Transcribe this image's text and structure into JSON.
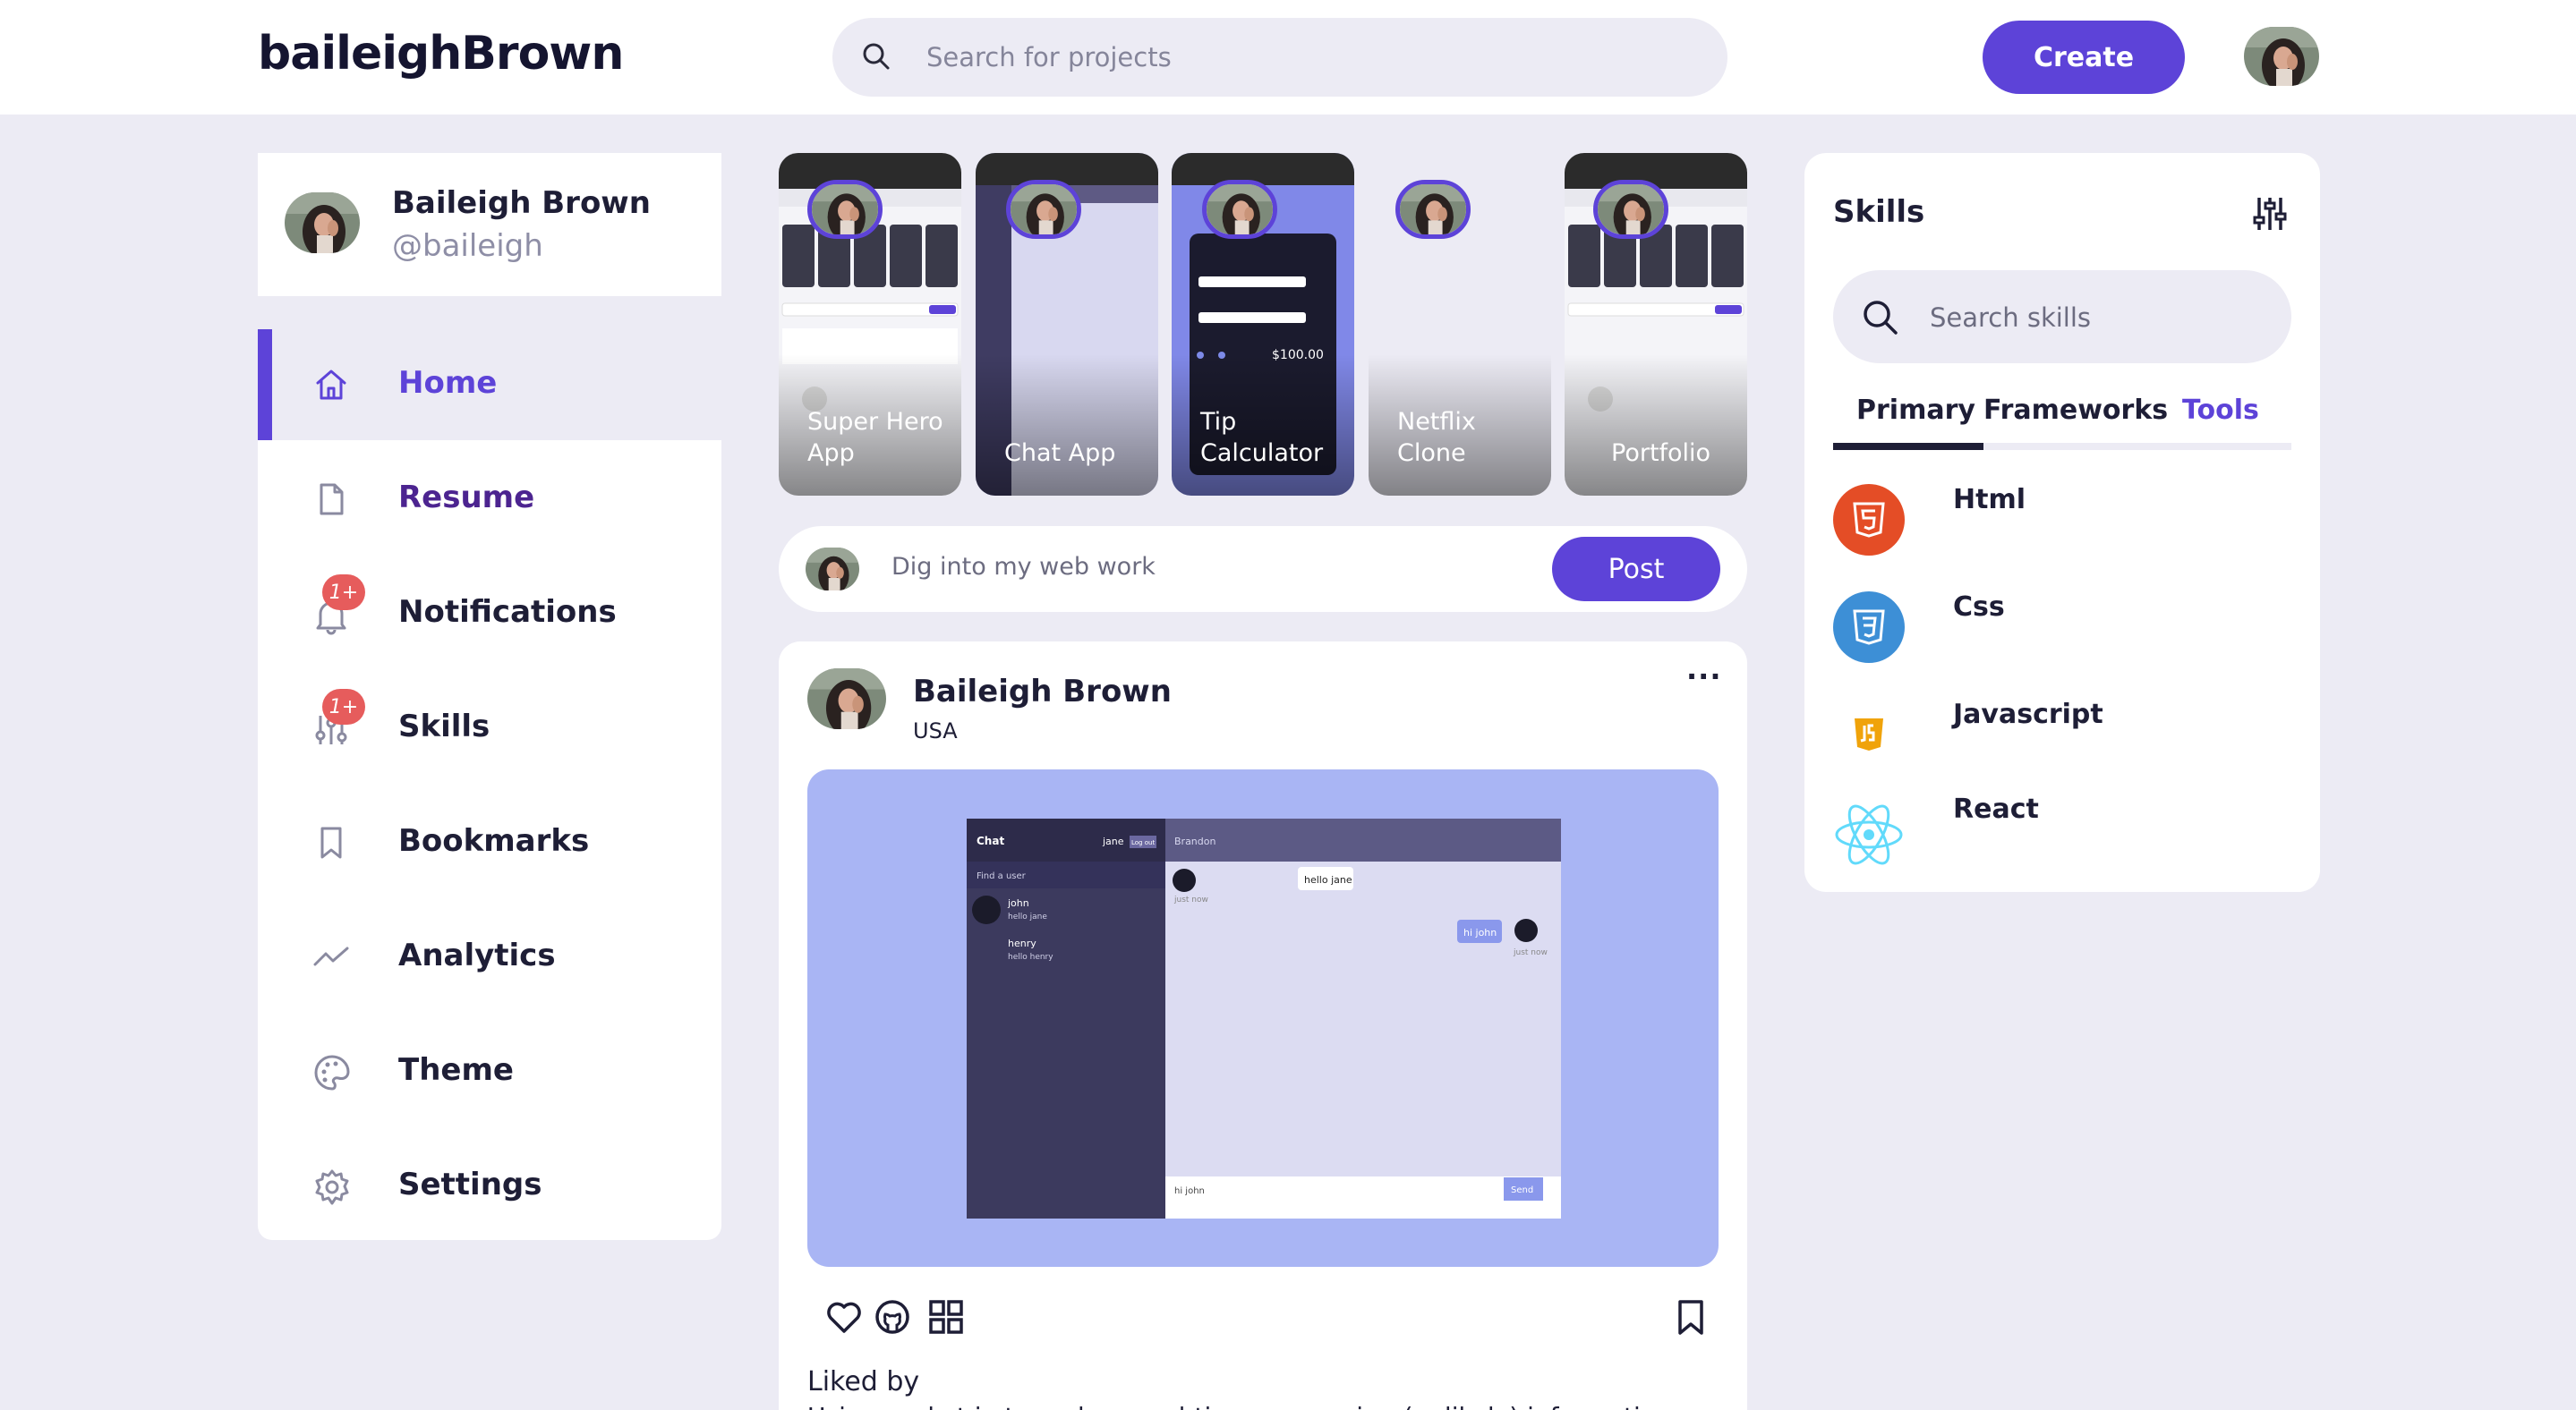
{
  "header": {
    "logo": "baileighBrown",
    "search_placeholder": "Search for projects",
    "create_label": "Create"
  },
  "profile": {
    "name": "Baileigh Brown",
    "handle": "@baileigh"
  },
  "nav": {
    "items": [
      {
        "label": "Home",
        "icon": "home-icon",
        "active": true
      },
      {
        "label": "Resume",
        "icon": "file-icon"
      },
      {
        "label": "Notifications",
        "icon": "bell-icon",
        "badge": "1+"
      },
      {
        "label": "Skills",
        "icon": "sliders-icon",
        "badge": "1+"
      },
      {
        "label": "Bookmarks",
        "icon": "bookmark-icon"
      },
      {
        "label": "Analytics",
        "icon": "trend-icon"
      },
      {
        "label": "Theme",
        "icon": "palette-icon"
      },
      {
        "label": "Settings",
        "icon": "gear-icon"
      }
    ]
  },
  "stories": [
    {
      "title": "Super Hero App"
    },
    {
      "title": "Chat App"
    },
    {
      "title": "Tip Calculator"
    },
    {
      "title": "Netflix Clone"
    },
    {
      "title": "Portfolio"
    }
  ],
  "composer": {
    "placeholder": "Dig into my web work",
    "post_label": "Post"
  },
  "post": {
    "author": "Baileigh Brown",
    "location": "USA",
    "more": "···",
    "liked_by": "Liked by",
    "caption_partial": "Using socket.io to make a real-time messaging (unlikely) information",
    "screenshot": {
      "sidebar_title": "Chat",
      "user": "jane",
      "logout": "Log out",
      "find": "Find a user",
      "contacts": [
        {
          "name": "john",
          "last": "hello jane"
        },
        {
          "name": "henry",
          "last": "hello henry"
        }
      ],
      "chat_with": "Brandon",
      "msg_in": "hello jane",
      "msg_in_time": "just now",
      "msg_out": "hi john",
      "msg_out_time": "just now",
      "input": "hi john",
      "send": "Send"
    }
  },
  "skills_panel": {
    "title": "Skills",
    "search_placeholder": "Search skills",
    "tabs": [
      "Primary",
      "Frameworks",
      "Tools"
    ],
    "items": [
      {
        "label": "Html",
        "icon": "html5-icon",
        "color": "#e44d26"
      },
      {
        "label": "Css",
        "icon": "css3-icon",
        "color": "#2965f1"
      },
      {
        "label": "Javascript",
        "icon": "js-icon",
        "color": "#f0a30a"
      },
      {
        "label": "React",
        "icon": "react-icon",
        "color": "#61dafb"
      }
    ]
  },
  "colors": {
    "accent": "#5d43d8",
    "background": "#ecebf4",
    "badge": "#e65c5c"
  }
}
